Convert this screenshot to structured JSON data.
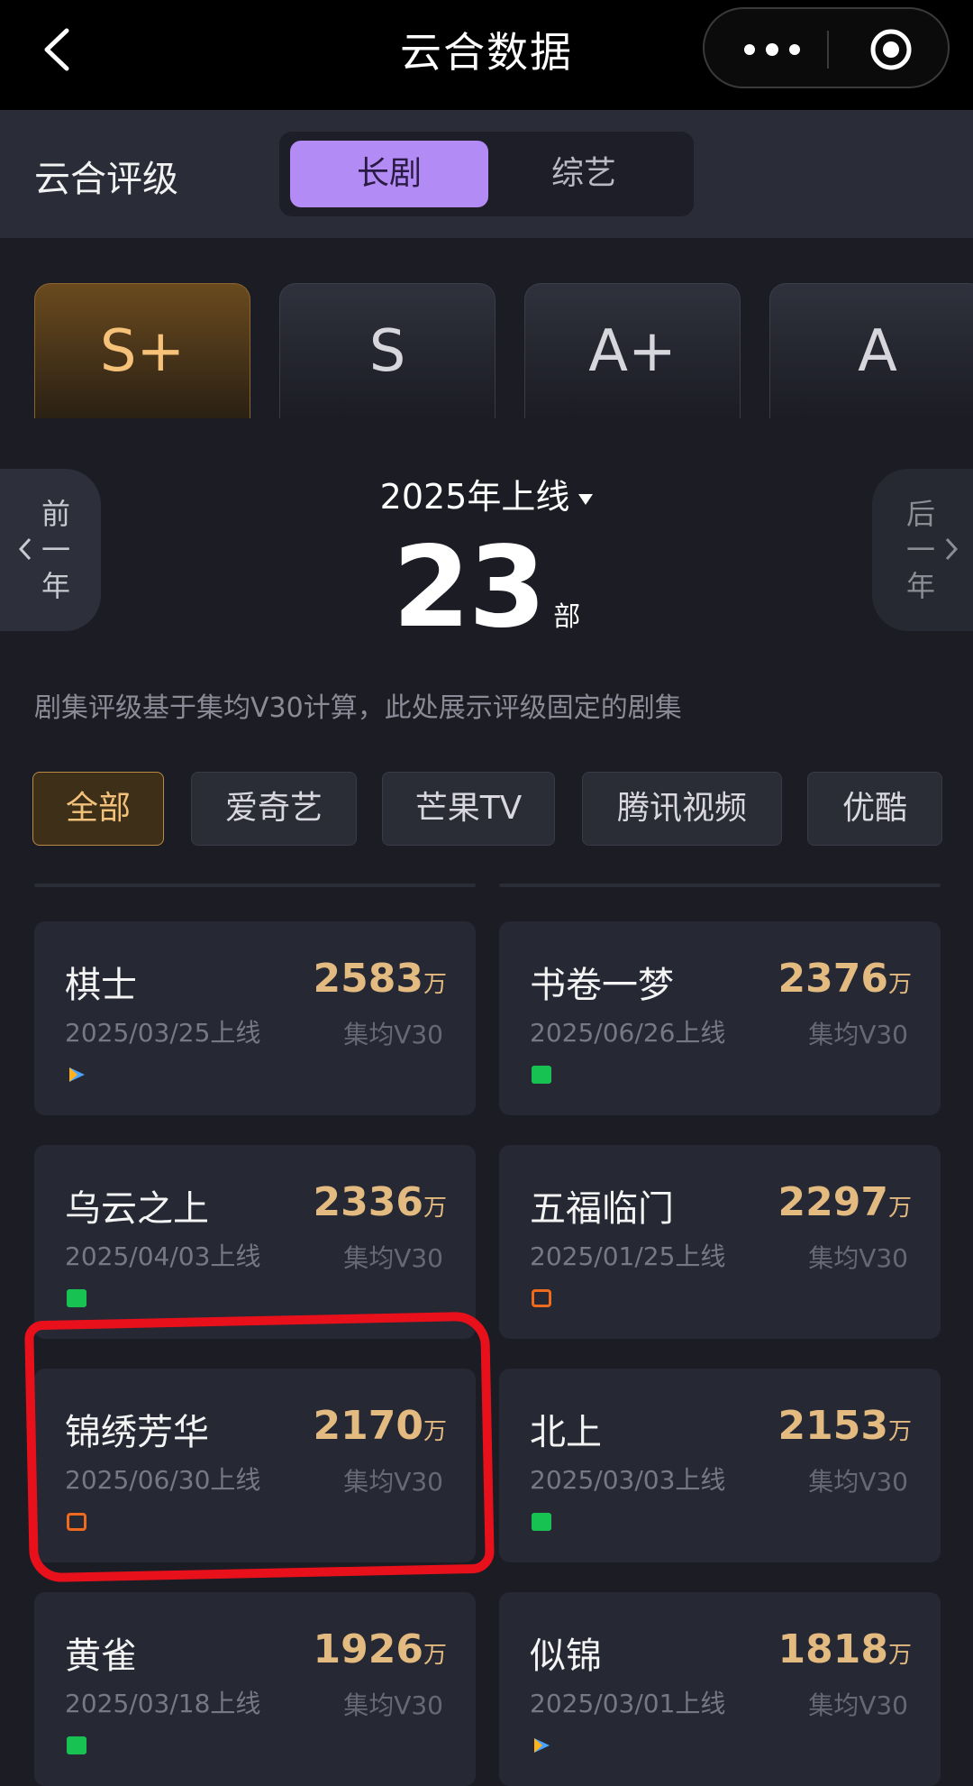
{
  "nav": {
    "title": "云合数据"
  },
  "rating": {
    "title": "云合评级",
    "tabs": [
      {
        "label": "长剧",
        "active": true
      },
      {
        "label": "综艺",
        "active": false
      }
    ]
  },
  "grades": [
    {
      "label": "S+",
      "active": true
    },
    {
      "label": "S",
      "active": false
    },
    {
      "label": "A+",
      "active": false
    },
    {
      "label": "A",
      "active": false
    }
  ],
  "year": {
    "prev_label": "前一年",
    "next_label": "后一年",
    "selected": "2025年上线",
    "count": "23",
    "count_unit": "部"
  },
  "note": "剧集评级基于集均V30计算，此处展示评级固定的剧集",
  "platforms": [
    {
      "label": "全部",
      "active": true
    },
    {
      "label": "爱奇艺",
      "active": false
    },
    {
      "label": "芒果TV",
      "active": false
    },
    {
      "label": "腾讯视频",
      "active": false
    },
    {
      "label": "优酷",
      "active": false
    }
  ],
  "shows": [
    {
      "title": "棋士",
      "date": "2025/03/25上线",
      "value": "2583",
      "unit": "万",
      "sub": "集均V30",
      "platform": "tencent-icon"
    },
    {
      "title": "书卷一梦",
      "date": "2025/06/26上线",
      "value": "2376",
      "unit": "万",
      "sub": "集均V30",
      "platform": "iqiyi-icon"
    },
    {
      "title": "乌云之上",
      "date": "2025/04/03上线",
      "value": "2336",
      "unit": "万",
      "sub": "集均V30",
      "platform": "iqiyi-icon"
    },
    {
      "title": "五福临门",
      "date": "2025/01/25上线",
      "value": "2297",
      "unit": "万",
      "sub": "集均V30",
      "platform": "mango-icon"
    },
    {
      "title": "锦绣芳华",
      "date": "2025/06/30上线",
      "value": "2170",
      "unit": "万",
      "sub": "集均V30",
      "platform": "mango-icon"
    },
    {
      "title": "北上",
      "date": "2025/03/03上线",
      "value": "2153",
      "unit": "万",
      "sub": "集均V30",
      "platform": "iqiyi-icon"
    },
    {
      "title": "黄雀",
      "date": "2025/03/18上线",
      "value": "1926",
      "unit": "万",
      "sub": "集均V30",
      "platform": "iqiyi-icon"
    },
    {
      "title": "似锦",
      "date": "2025/03/01上线",
      "value": "1818",
      "unit": "万",
      "sub": "集均V30",
      "platform": "tencent-icon"
    }
  ],
  "colors": {
    "accent_gold": "#e3ba7f",
    "tab_purple": "#b38bf4",
    "highlight_red": "#e8101b",
    "iqiyi_green": "#17c253",
    "mango_orange": "#f06a1d"
  }
}
